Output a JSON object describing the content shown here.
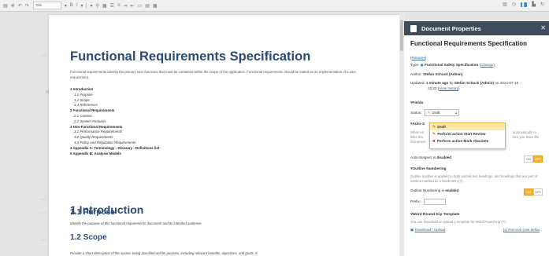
{
  "toolbar": {
    "style_select": "Title",
    "right_active": "Document Properties"
  },
  "document": {
    "title": "Functional Requirements Specification",
    "intro": "Functional requirements identify the primary user functions that must be contained within the scope of the application. Functional requirements should be stated as an implementation of a user requirement.",
    "toc": [
      {
        "text": "1 Introduction",
        "level": 1
      },
      {
        "text": "1.1 Purpose",
        "level": 2
      },
      {
        "text": "1.2 Scope",
        "level": 2
      },
      {
        "text": "1.3 References",
        "level": 2
      },
      {
        "text": "2 Functional Requirements",
        "level": 1
      },
      {
        "text": "2.1 Context",
        "level": 2
      },
      {
        "text": "2.2 System Features",
        "level": 2
      },
      {
        "text": "3 Non-Functional Requirements",
        "level": 1
      },
      {
        "text": "3.1 Performance Requirements",
        "level": 2
      },
      {
        "text": "3.2 Quality Requirements",
        "level": 2
      },
      {
        "text": "3.3 Policy and Regulation Requirements",
        "level": 2
      },
      {
        "text": "4 Appendix A: Terminology - Glossary - Definitions list",
        "level": 1
      },
      {
        "text": "5 Appendix B: Analysis Models",
        "level": 1
      }
    ],
    "h1_intro": "1 Introduction",
    "h2_purpose": "1.1 Purpose",
    "purpose_text": "Identify the purpose of this functional requirements document and its intended audience.",
    "h2_scope": "1.2 Scope",
    "scope_text": "Provide a short description of the system being specified and its purpose, including relevant benefits, objectives, and goals. If"
  },
  "panel": {
    "header": "Document Properties",
    "doc_title": "Functional Requirements Specification",
    "rename": "Rename",
    "type_label": "Type:",
    "type_value": "Functional Safety Specification",
    "change": "Change",
    "author_label": "Author:",
    "author_value": "Stefan Schuck (Admin)",
    "updated_label": "Updated:",
    "updated_time": "1 minute ago",
    "updated_by": "by",
    "updated_user": "Stefan Schuck (Admin)",
    "updated_on": "on 2014-07-10",
    "updated_clock": "12:22",
    "view_history": "View history",
    "fields_section": "Fields",
    "status_label": "Status:",
    "status_value": "Draft",
    "dropdown": [
      {
        "label": "Draft",
        "icon": "pencil"
      },
      {
        "label": "Perform action Start Review",
        "icon": "pencil"
      },
      {
        "label": "Perform action Mark Obsolete",
        "icon": "x"
      }
    ],
    "autosuspect_section": "Auto-S",
    "autosuspect_desc_1": "When en",
    "autosuspect_desc_1r": "automatically to",
    "autosuspect_desc_2": "links tha",
    "autosuspect_desc_2r": "hen you Save the",
    "autosuspect_desc_3": "Document.",
    "autosuspect_label": "Auto-Suspect is",
    "autosuspect_state": "disabled",
    "outline_section": "Outline Numbering",
    "outline_desc": "Outline number is applied to both normal text headings, and headings that are part of content marked as a Work Item (?).",
    "outline_label": "Outline Numbering is",
    "outline_state": "enabled",
    "prefix_label": "Prefix:",
    "roundtrip_section": "Word Round-trip Template",
    "roundtrip_desc": "You can download or upload a template for Word Round-trip (?).",
    "download_upload": "Download | Upload",
    "remove": "[x] Remove (use defau",
    "toggle_on": "ON",
    "toggle_off": "OFF"
  },
  "colors": {
    "heading": "#2a4b74",
    "panel_header": "#3f4d5a",
    "link": "#2f6dad",
    "highlight": "#fbe9a8",
    "toggle_active": "#f5b335"
  }
}
